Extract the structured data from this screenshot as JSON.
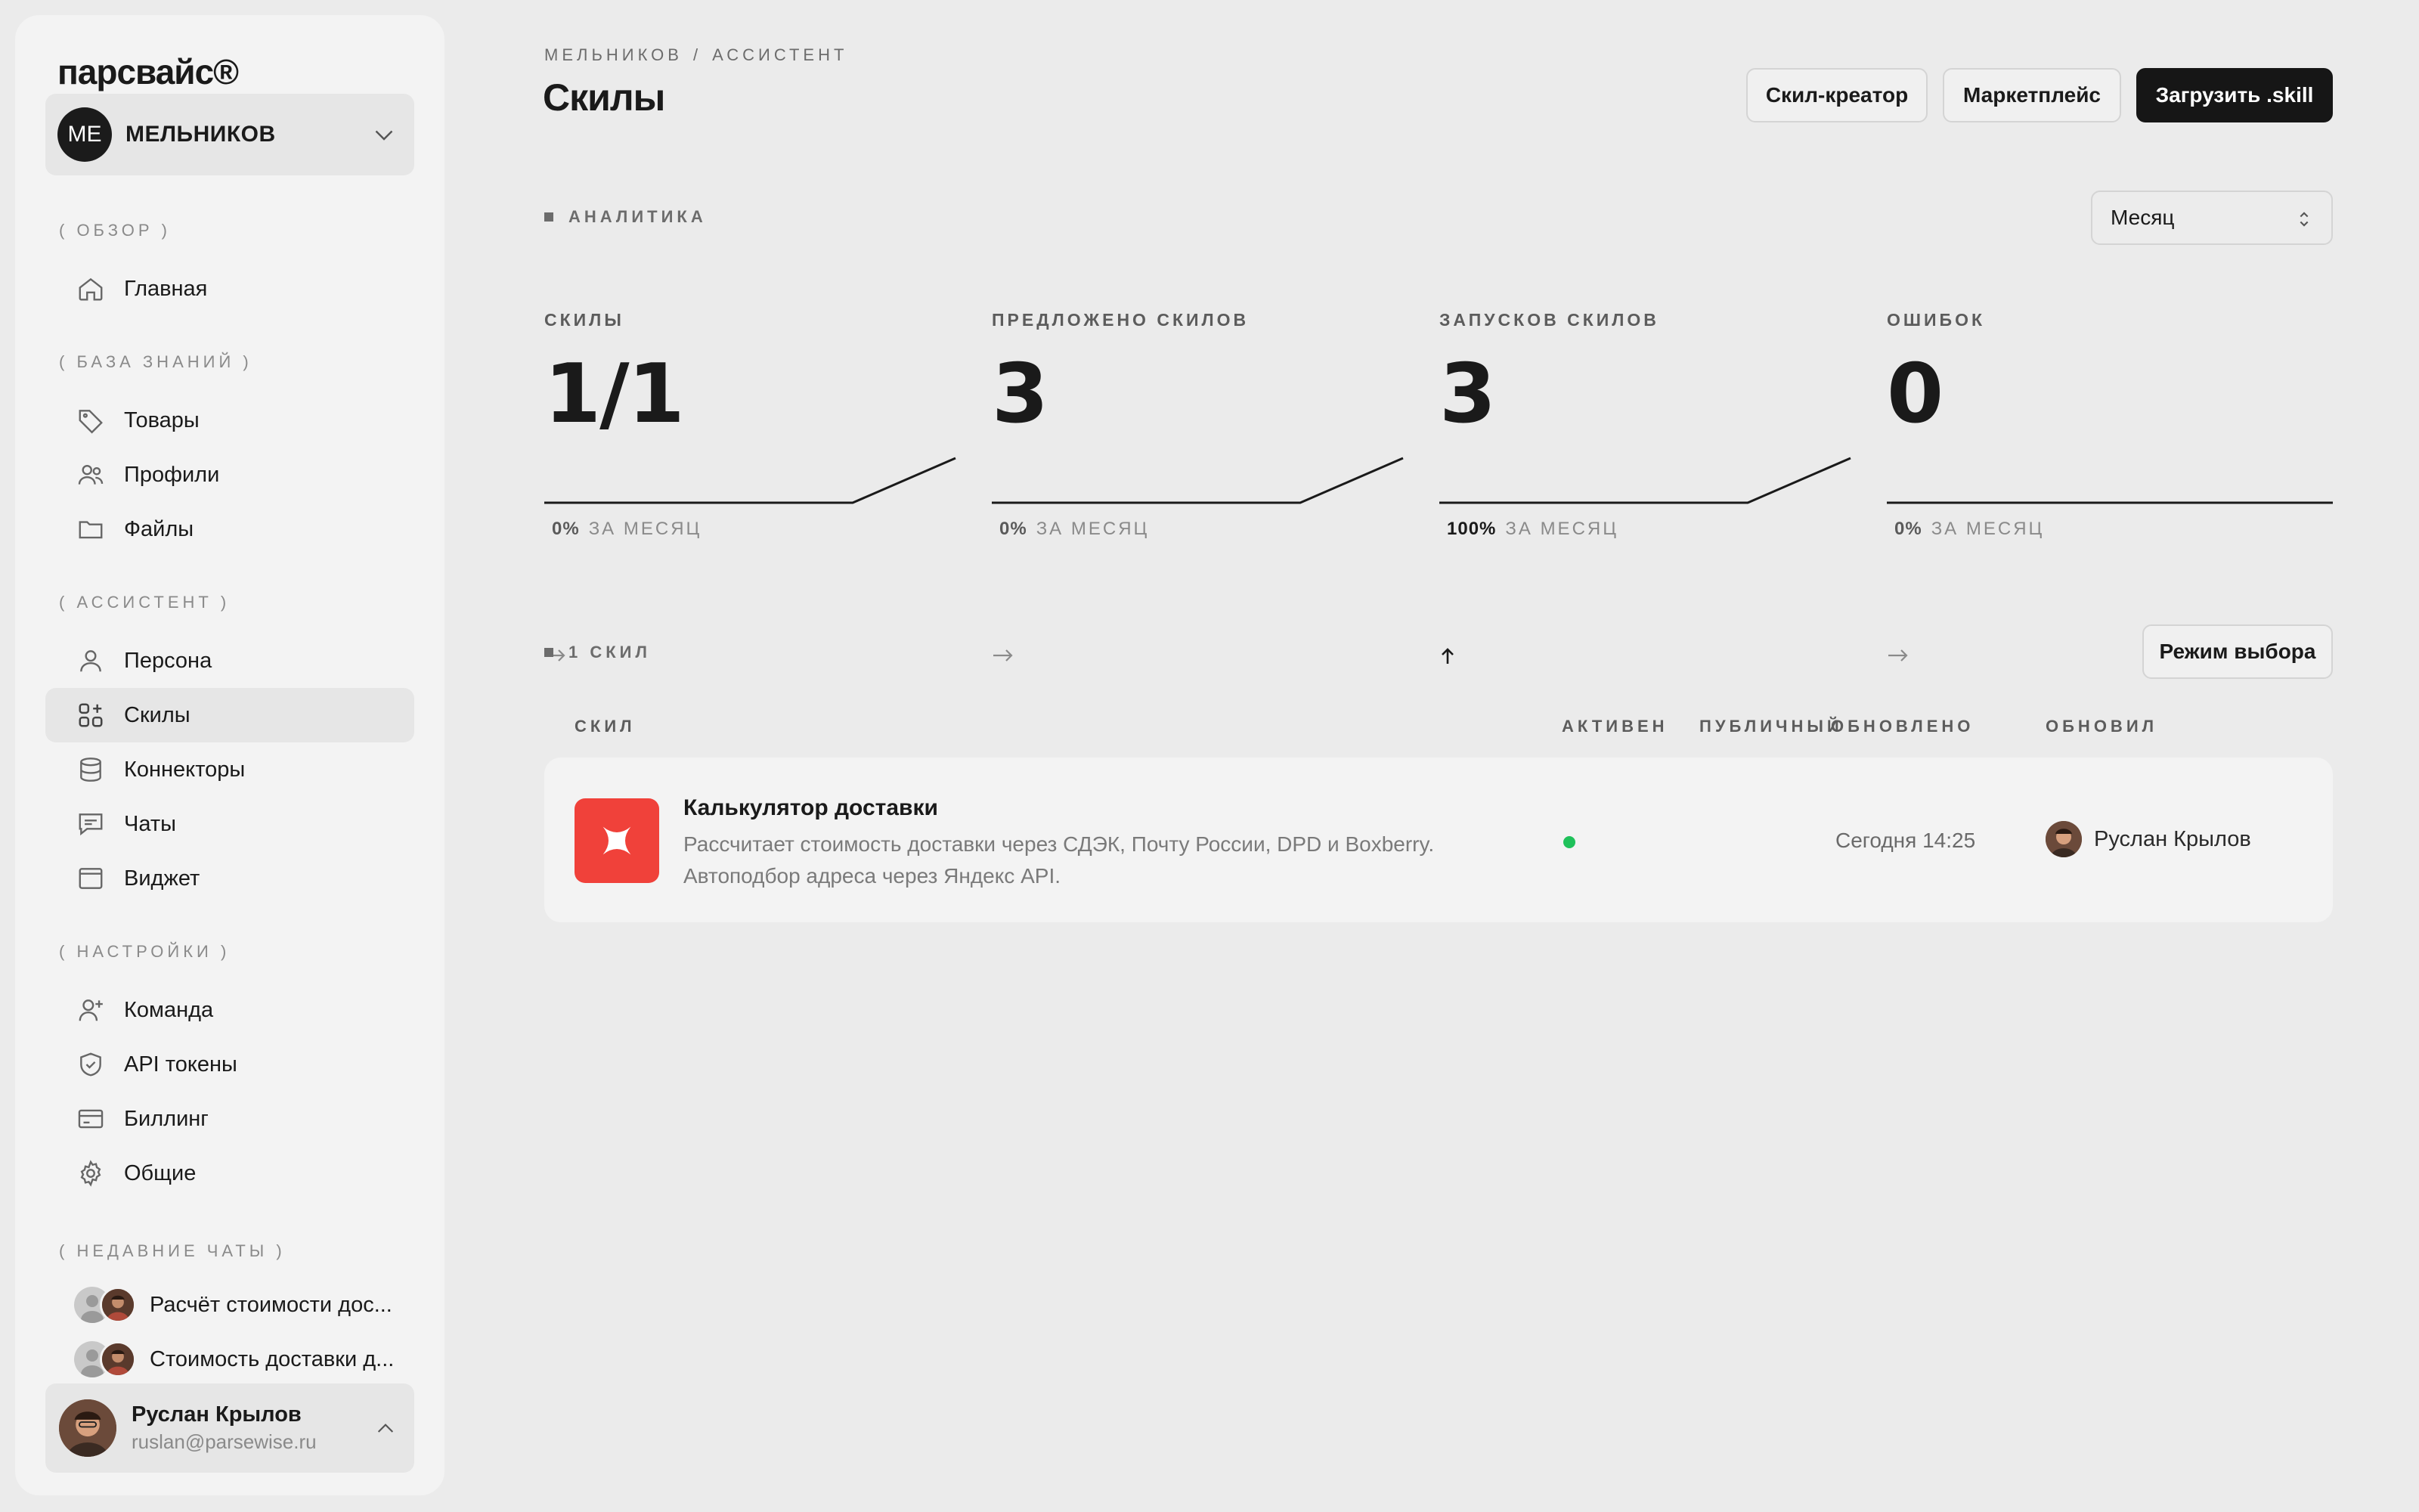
{
  "brand": "парсвайс®",
  "org": {
    "initials": "МЕ",
    "name": "МЕЛЬНИКОВ"
  },
  "sidebar": {
    "sections": [
      {
        "label": "( ОБЗОР )"
      },
      {
        "label": "( БАЗА ЗНАНИЙ )"
      },
      {
        "label": "( АССИСТЕНТ )"
      },
      {
        "label": "( НАСТРОЙКИ )"
      },
      {
        "label": "( НЕДАВНИЕ ЧАТЫ )"
      }
    ],
    "items": [
      {
        "label": "Главная",
        "icon": "home-icon"
      },
      {
        "label": "Товары",
        "icon": "tag-icon"
      },
      {
        "label": "Профили",
        "icon": "users-icon"
      },
      {
        "label": "Файлы",
        "icon": "folder-icon"
      },
      {
        "label": "Персона",
        "icon": "user-icon"
      },
      {
        "label": "Скилы",
        "icon": "skills-icon",
        "active": true
      },
      {
        "label": "Коннекторы",
        "icon": "database-icon"
      },
      {
        "label": "Чаты",
        "icon": "chat-icon"
      },
      {
        "label": "Виджет",
        "icon": "widget-icon"
      },
      {
        "label": "Команда",
        "icon": "user-plus-icon"
      },
      {
        "label": "API токены",
        "icon": "shield-icon"
      },
      {
        "label": "Биллинг",
        "icon": "credit-card-icon"
      },
      {
        "label": "Общие",
        "icon": "gear-icon"
      }
    ],
    "recent_chats": [
      {
        "label": "Расчёт стоимости дос..."
      },
      {
        "label": "Стоимость доставки д..."
      }
    ]
  },
  "user": {
    "name": "Руслан Крылов",
    "email": "ruslan@parsewise.ru"
  },
  "header": {
    "breadcrumb": [
      "МЕЛЬНИКОВ",
      "АССИСТЕНТ"
    ],
    "breadcrumb_sep": "/",
    "title": "Скилы",
    "buttons": {
      "creator": "Скил-креатор",
      "marketplace": "Маркетплейс",
      "upload": "Загрузить .skill"
    }
  },
  "analytics": {
    "label": "АНАЛИТИКА",
    "period": "Месяц",
    "footer_suffix": "ЗА МЕСЯЦ",
    "stats": [
      {
        "title": "СКИЛЫ",
        "value": "1/1",
        "change": "0%",
        "trend": "flat"
      },
      {
        "title": "ПРЕДЛОЖЕНО СКИЛОВ",
        "value": "3",
        "change": "0%",
        "trend": "flat"
      },
      {
        "title": "ЗАПУСКОВ СКИЛОВ",
        "value": "3",
        "change": "100%",
        "trend": "up"
      },
      {
        "title": "ОШИБОК",
        "value": "0",
        "change": "0%",
        "trend": "flat"
      }
    ]
  },
  "skills": {
    "count_label": "1 СКИЛ",
    "mode_button": "Режим выбора",
    "columns": [
      "СКИЛ",
      "АКТИВЕН",
      "ПУБЛИЧНЫЙ",
      "ОБНОВЛЕНО",
      "ОБНОВИЛ"
    ],
    "rows": [
      {
        "name": "Калькулятор доставки",
        "description_line1": "Рассчитает стоимость доставки через СДЭК, Почту России, DPD и Boxberry.",
        "description_line2": "Автоподбор адреса через Яндекс API.",
        "active": true,
        "active_color": "#1fc15a",
        "updated": "Сегодня 14:25",
        "updated_by": "Руслан Крылов"
      }
    ]
  },
  "colors": {
    "accent_dark": "#161616",
    "skill_icon_bg": "#f0413a",
    "active_dot": "#1fc15a"
  }
}
